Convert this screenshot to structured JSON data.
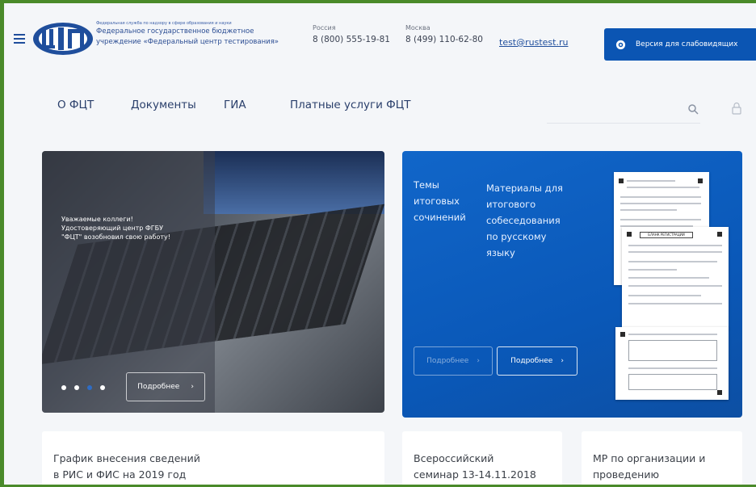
{
  "header": {
    "org_small": "Федеральная служба по надзору в сфере образования и науки",
    "org_line1": "Федеральное государственное бюджетное",
    "org_line2": "учреждение «Федеральный центр тестирования»",
    "phones": [
      {
        "label": "Россия",
        "number": "8 (800) 555-19-81"
      },
      {
        "label": "Москва",
        "number": "8 (499) 110-62-80"
      }
    ],
    "email": "test@rustest.ru",
    "vision_button": "Версия для слабовидящих"
  },
  "nav": {
    "items": [
      "О ФЦТ",
      "Документы",
      "ГИА",
      "Платные услуги ФЦТ"
    ]
  },
  "banner_left": {
    "text_line1": "Уважаемые коллеги!",
    "text_line2": "Удостоверяющий центр ФГБУ",
    "text_line3": "\"ФЦТ\" возобновил свою работу!",
    "more_label": "Подробнее",
    "slides_total": 4,
    "slide_active": 3
  },
  "banner_right": {
    "topic1_lines": [
      "Темы",
      "итоговых",
      "сочинений"
    ],
    "topic2_lines": [
      "Материалы для",
      "итогового",
      "собеседования",
      "по русскому",
      "языку"
    ],
    "more_label_1": "Подробнее",
    "more_label_2": "Подробнее",
    "form_title": "БЛАНК РЕГИСТРАЦИИ"
  },
  "cards": [
    {
      "line1": "График внесения сведений",
      "line2": "в РИС и ФИС на 2019 год"
    },
    {
      "line1": "Всероссийский",
      "line2": "семинар 13-14.11.2018"
    },
    {
      "line1": "МР по организации и",
      "line2": "проведению"
    }
  ],
  "colors": {
    "brand_blue": "#0b55b3",
    "frame_green": "#4a8a2a",
    "nav_text": "#2a3f6b"
  }
}
